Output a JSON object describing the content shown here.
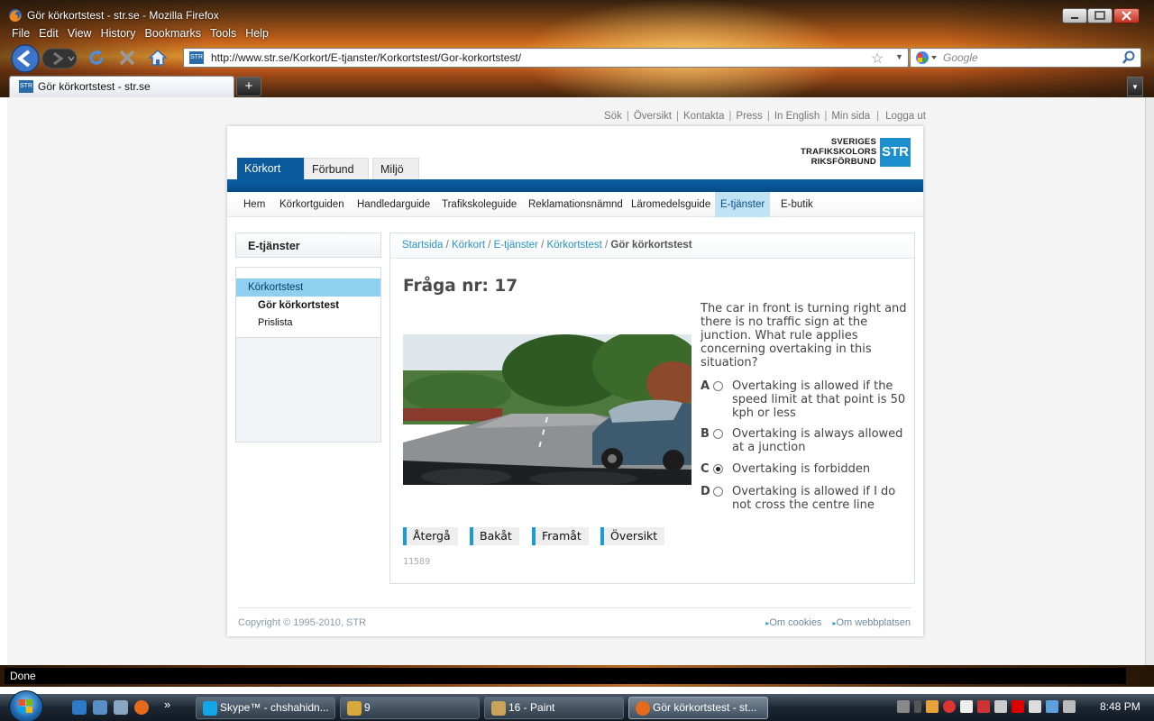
{
  "window": {
    "title": "Gör körkortstest - str.se - Mozilla Firefox"
  },
  "menu": [
    "File",
    "Edit",
    "View",
    "History",
    "Bookmarks",
    "Tools",
    "Help"
  ],
  "nav": {
    "url": "http://www.str.se/Korkort/E-tjanster/Korkortstest/Gor-korkortstest/",
    "site_badge": "STR",
    "search_placeholder": "Google"
  },
  "tab": {
    "label": "Gör körkortstest - str.se",
    "new_tab": "+"
  },
  "top_links": [
    "Sök",
    "Översikt",
    "Kontakta",
    "Press",
    "In English",
    "Min sida",
    "Logga ut"
  ],
  "logo": {
    "line1": "SVERIGES",
    "line2": "TRAFIKSKOLORS",
    "line3": "RIKSFÖRBUND",
    "mark": "STR"
  },
  "section_tabs": [
    "Körkort",
    "Förbund",
    "Miljö"
  ],
  "subnav": [
    "Hem",
    "Körkortguiden",
    "Handledarguide",
    "Trafikskoleguide",
    "Reklamationsnämnd",
    "Läromedelsguide",
    "E-tjänster",
    "E-butik"
  ],
  "sidebar": {
    "title": "E-tjänster",
    "items": [
      "Körkortstest",
      "Gör körkortstest",
      "Prislista"
    ]
  },
  "breadcrumb": {
    "items": [
      "Startsida",
      "Körkort",
      "E-tjänster",
      "Körkortstest"
    ],
    "current": "Gör körkortstest"
  },
  "question": {
    "title": "Fråga nr: 17",
    "text": "The car in front is turning right and there is no traffic sign at the junction. What rule applies concerning overtaking in this situation?",
    "options": [
      {
        "letter": "A",
        "text": "Overtaking is allowed if the speed limit at that point is 50 kph or less",
        "selected": false
      },
      {
        "letter": "B",
        "text": "Overtaking is always allowed at a junction",
        "selected": false
      },
      {
        "letter": "C",
        "text": "Overtaking is forbidden",
        "selected": true
      },
      {
        "letter": "D",
        "text": "Overtaking is allowed if I do not cross the centre line",
        "selected": false
      }
    ],
    "buttons": [
      "Återgå",
      "Bakåt",
      "Framåt",
      "Översikt"
    ],
    "id": "11589"
  },
  "footer": {
    "copyright": "Copyright © 1995-2010, STR",
    "links": [
      "Om cookies",
      "Om webbplatsen"
    ]
  },
  "status": {
    "text": "Done"
  },
  "taskbar": {
    "tasks": [
      "Skype™ - chshahidn...",
      "9",
      "16 - Paint",
      "Gör körkortstest - st..."
    ],
    "clock": "8:48 PM"
  },
  "colors": {
    "brand_blue": "#0b5a9e",
    "accent": "#1c9ad8",
    "active_subnav": "#bfe2f5"
  }
}
